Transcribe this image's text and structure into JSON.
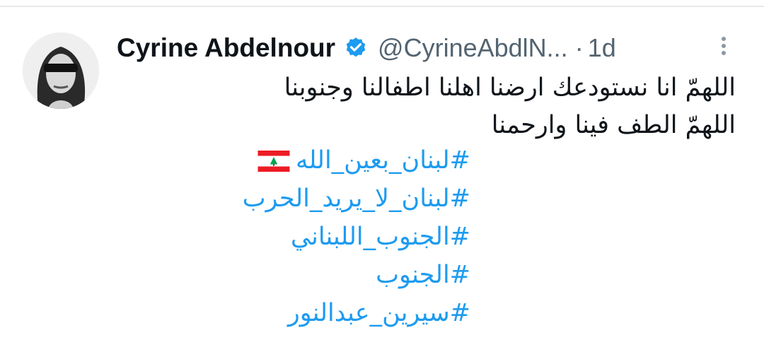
{
  "tweet": {
    "author_name": "Cyrine Abdelnour",
    "handle": "@CyrineAbdlN...",
    "separator": "·",
    "time": "1d",
    "lines": [
      "اللهمّ انا نستودعك ارضنا اهلنا اطفالنا وجنوبنا",
      "اللهمّ الطف فينا وارحمنا"
    ],
    "hashtags": [
      "#لبنان_بعين_الله",
      "#لبنان_لا_يريد_الحرب",
      "#الجنوب_اللبناني",
      "#الجنوب",
      "#سيرين_عبدالنور"
    ],
    "verified_badge_color": "#1d9bf0",
    "hashtag_color": "#1d9bf0",
    "icons": [
      "avatar",
      "verified-badge-icon",
      "more-options-icon",
      "lebanon-flag-icon"
    ]
  }
}
